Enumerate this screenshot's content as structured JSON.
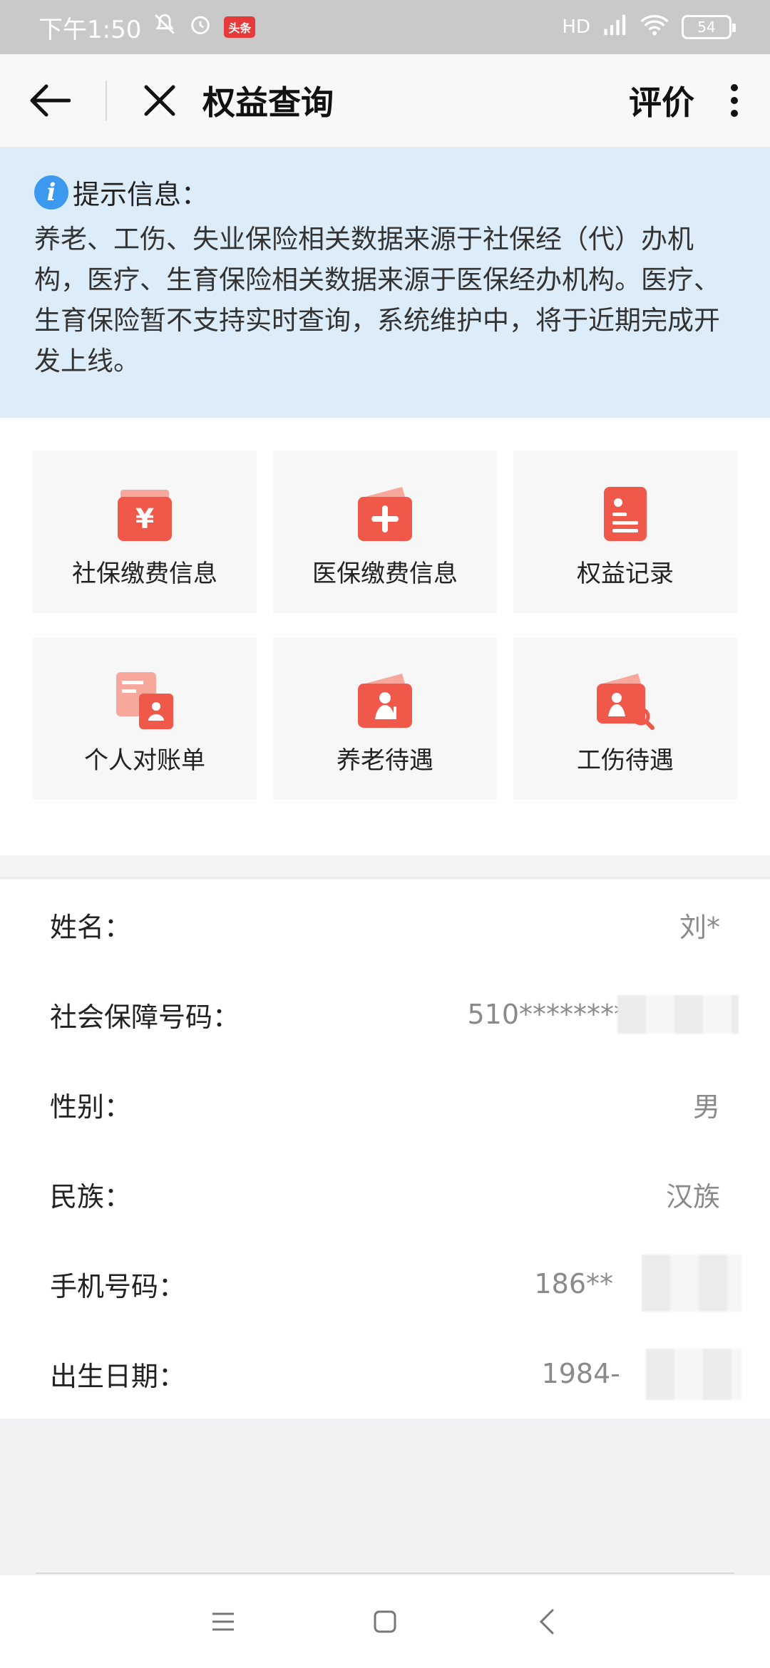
{
  "status": {
    "time": "下午1:50",
    "badge": "头条",
    "network": "HD",
    "battery": "54"
  },
  "header": {
    "title": "权益查询",
    "rate_label": "评价"
  },
  "notice": {
    "title": "提示信息：",
    "body": "养老、工伤、失业保险相关数据来源于社保经（代）办机构，医疗、生育保险相关数据来源于医保经办机构。医疗、生育保险暂不支持实时查询，系统维护中，将于近期完成开发上线。"
  },
  "tiles": [
    {
      "label": "社保缴费信息",
      "icon": "yuan-card-icon"
    },
    {
      "label": "医保缴费信息",
      "icon": "medical-card-icon"
    },
    {
      "label": "权益记录",
      "icon": "record-icon"
    },
    {
      "label": "个人对账单",
      "icon": "statement-icon"
    },
    {
      "label": "养老待遇",
      "icon": "elderly-card-icon"
    },
    {
      "label": "工伤待遇",
      "icon": "injury-search-icon"
    }
  ],
  "profile": [
    {
      "key": "姓名：",
      "value": "刘*"
    },
    {
      "key": "社会保障号码：",
      "value": "510********"
    },
    {
      "key": "性别：",
      "value": "男"
    },
    {
      "key": "民族：",
      "value": "汉族"
    },
    {
      "key": "手机号码：",
      "value": "186**"
    },
    {
      "key": "出生日期：",
      "value": "1984-"
    }
  ],
  "colors": {
    "accent": "#f0584a",
    "notice_bg": "#dcecf8",
    "info_blue": "#3b9af0"
  }
}
